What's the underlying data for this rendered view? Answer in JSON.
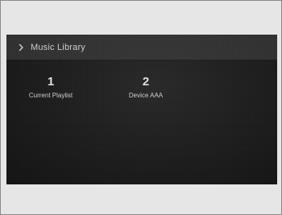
{
  "header": {
    "icon": "chevron-right-icon",
    "title": "Music Library"
  },
  "items": [
    {
      "number": "1",
      "label": "Current Playlist"
    },
    {
      "number": "2",
      "label": "Device AAA"
    }
  ],
  "colors": {
    "background": "#e6e6e6",
    "screen": "#1d1d1d",
    "text": "#e2e2e2"
  }
}
